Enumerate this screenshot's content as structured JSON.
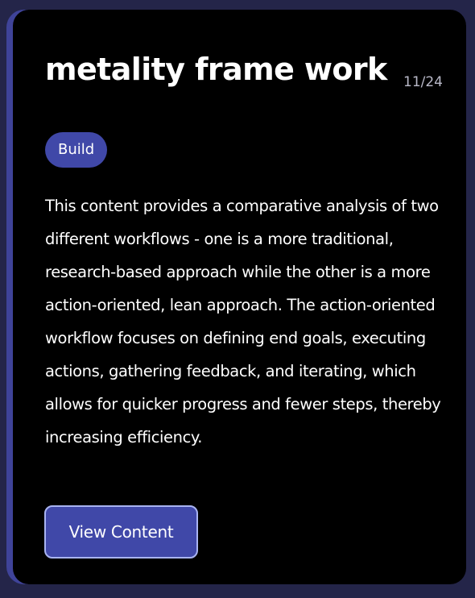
{
  "card": {
    "title": "metality frame work",
    "date": "11/24",
    "tag": "Build",
    "description": "This content provides a comparative analysis of two different workflows - one is a more traditional, research-based approach while the other is a more action-oriented, lean approach. The action-oriented workflow focuses on defining end goals, executing actions, gathering feedback, and iterating, which allows for quicker progress and fewer steps, thereby increasing efficiency.",
    "button_label": "View Content"
  },
  "colors": {
    "background": "#242549",
    "card": "#000000",
    "accent": "#4048a8",
    "button_border": "#a9b4f2",
    "date_text": "#b9b9c8"
  }
}
